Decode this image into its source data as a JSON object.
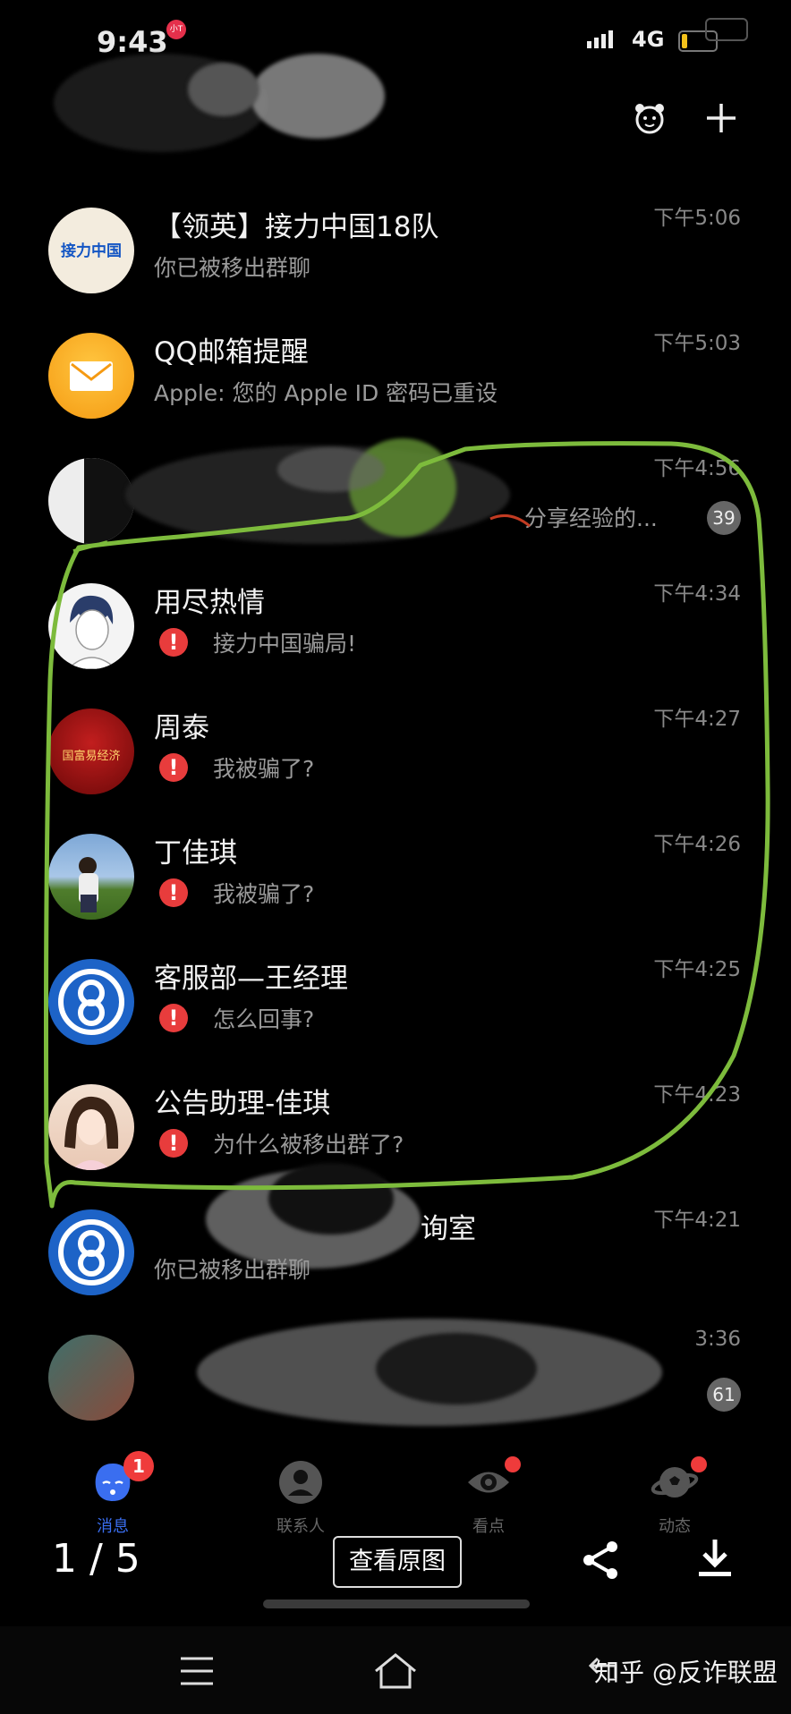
{
  "status": {
    "time": "9:43",
    "recording_label": "小T",
    "network": "4G"
  },
  "header": {
    "add_label": "+"
  },
  "chats": [
    {
      "name": "【领英】接力中国18队",
      "preview": "你已被移出群聊",
      "time": "下午5:06",
      "warning": false,
      "avatar": "jieli-logo",
      "avatar_text": "接力中国"
    },
    {
      "name": "QQ邮箱提醒",
      "preview": "Apple: 您的 Apple ID 密码已重设",
      "time": "下午5:03",
      "warning": false,
      "avatar": "mail"
    },
    {
      "name": "",
      "preview": "分享经验的...",
      "time": "下午4:56",
      "warning": false,
      "avatar": "obscured",
      "badge": "39"
    },
    {
      "name": "用尽热情",
      "preview": "接力中国骗局!",
      "time": "下午4:34",
      "warning": true,
      "avatar": "anime-boy"
    },
    {
      "name": "周泰",
      "preview": "我被骗了?",
      "time": "下午4:27",
      "warning": true,
      "avatar": "red-poster",
      "avatar_text": "国富易经济"
    },
    {
      "name": "丁佳琪",
      "preview": "我被骗了?",
      "time": "下午4:26",
      "warning": true,
      "avatar": "photo-girl"
    },
    {
      "name": "客服部—王经理",
      "preview": "怎么回事?",
      "time": "下午4:25",
      "warning": true,
      "avatar": "blue-logo"
    },
    {
      "name": "公告助理-佳琪",
      "preview": "为什么被移出群了?",
      "time": "下午4:23",
      "warning": true,
      "avatar": "anime-girl"
    },
    {
      "name": "询室",
      "preview": "你已被移出群聊",
      "time": "下午4:21",
      "warning": false,
      "avatar": "blue-logo"
    },
    {
      "name": "",
      "preview": "",
      "time": "3:36",
      "warning": false,
      "avatar": "obscured-2",
      "badge": "61"
    }
  ],
  "tabs": [
    {
      "label": "消息",
      "badge": "1",
      "icon": "message-face-icon",
      "active": true
    },
    {
      "label": "联系人",
      "icon": "contact-icon"
    },
    {
      "label": "看点",
      "icon": "eye-icon",
      "dot": true
    },
    {
      "label": "动态",
      "icon": "planet-icon",
      "dot": true
    }
  ],
  "viewer": {
    "pager": "1 / 5",
    "view_original": "查看原图"
  },
  "watermark": "知乎 @反诈联盟",
  "colors": {
    "warning": "#e83c3c",
    "badge": "#ef3b3b",
    "highlight": "#7dbb3c",
    "tab_active": "#3a6ef0"
  }
}
